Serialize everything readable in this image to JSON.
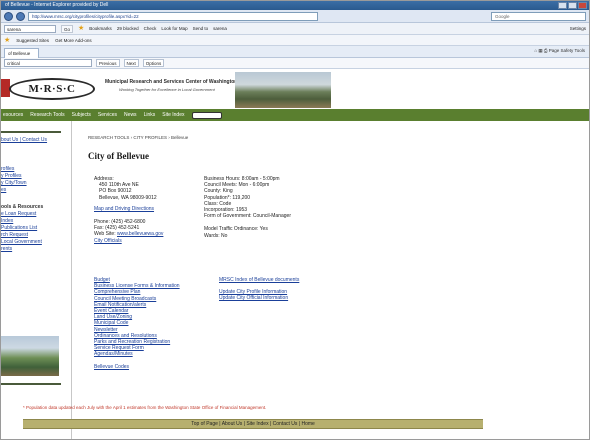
{
  "browser": {
    "title_bar": "of Bellevue - Internet Explorer provided by Dell",
    "url": "http://www.mrsc.org/cityprofiles/cityprofile.aspx?id=22",
    "search_placeholder": "Google",
    "toolbar": {
      "field_value": "sarena",
      "go_label": "Go",
      "bookmarks": "Bookmarks",
      "blocked": "29 blocked",
      "check": "Check",
      "look_for_map": "Look for Map",
      "send_to": "Send to",
      "user": "sarena",
      "settings": "Settings"
    },
    "favorites": {
      "suggested_sites": "Suggested Sites",
      "get_more_addons": "Get More Add-ons"
    },
    "tab": {
      "label": "of Bellevue"
    },
    "command_bar": [
      "Page",
      "Safety",
      "Tools"
    ],
    "find": {
      "value": "critical",
      "previous": "Previous",
      "next": "Next",
      "options": "Options"
    }
  },
  "site": {
    "logo_text": "M·R·S·C",
    "org_name": "Municipal Research and Services Center of Washington",
    "tagline": "Working Together for Excellence in Local Government",
    "nav": [
      "esources",
      "Research Tools",
      "Subjects",
      "Services",
      "News",
      "Links",
      "Site Index"
    ],
    "nav_search": "Site Search"
  },
  "sidebar": {
    "top_link": "bout Us | Contact Us",
    "profile_links": [
      "rofiles",
      "y Profiles",
      "y City/Town",
      "es"
    ],
    "section_title": "ools & Resources",
    "resource_links": [
      "e Loan Request",
      "Index",
      "Publications List",
      "rch Request",
      "Local Government",
      "rents"
    ]
  },
  "content": {
    "breadcrumb": "RESEARCH TOOLS › CITY PROFILES › Bellevue",
    "title": "City of Bellevue",
    "address": {
      "label": "Address:",
      "line1": "450 110th Ave NE",
      "line2": "PO Box 90012",
      "line3": "Bellevue, WA 98009-9012"
    },
    "map_link": "Map and Driving Directions",
    "phone": "Phone: (425) 452-6800",
    "fax": "Fax: (425) 452-5241",
    "website_label": "Web Site:",
    "website_url": "www.bellevuewa.gov",
    "city_officials": "City Officials",
    "details": [
      "Business Hours: 8:00am - 5:00pm",
      "Council Meets: Mon - 6:00pm",
      "County: King",
      "Population*: 119,200",
      "Class: Code",
      "Incorporation: 1953",
      "Form of Government: Council-Manager"
    ],
    "model_traffic": "Model Traffic Ordinance: Yes",
    "wards": "Wards: No",
    "doc_links": [
      "Budget",
      "Business License Forms & Information",
      "Comprehensive Plan",
      "Council Meeting Broadcasts",
      "Email Notification/alerts",
      "Event Calendar",
      "Land Use/Zoning",
      "Municipal Code",
      "Newsletter",
      "Ordinances and Resolutions",
      "Parks and Recreation Registration",
      "Service Request Form",
      "Agendas/Minutes"
    ],
    "codes_link": "Bellevue Codes",
    "mrsc_index": "MRSC Index of Bellevue documents",
    "update_profile": "Update City Profile Information",
    "update_official": "Update City Official Information",
    "population_note": "* Population data updated each July with the April 1 estimates from the Washington State Office of Financial Management.",
    "footer": "Top of Page | About Us | Site Index | Contact Us | Home"
  }
}
